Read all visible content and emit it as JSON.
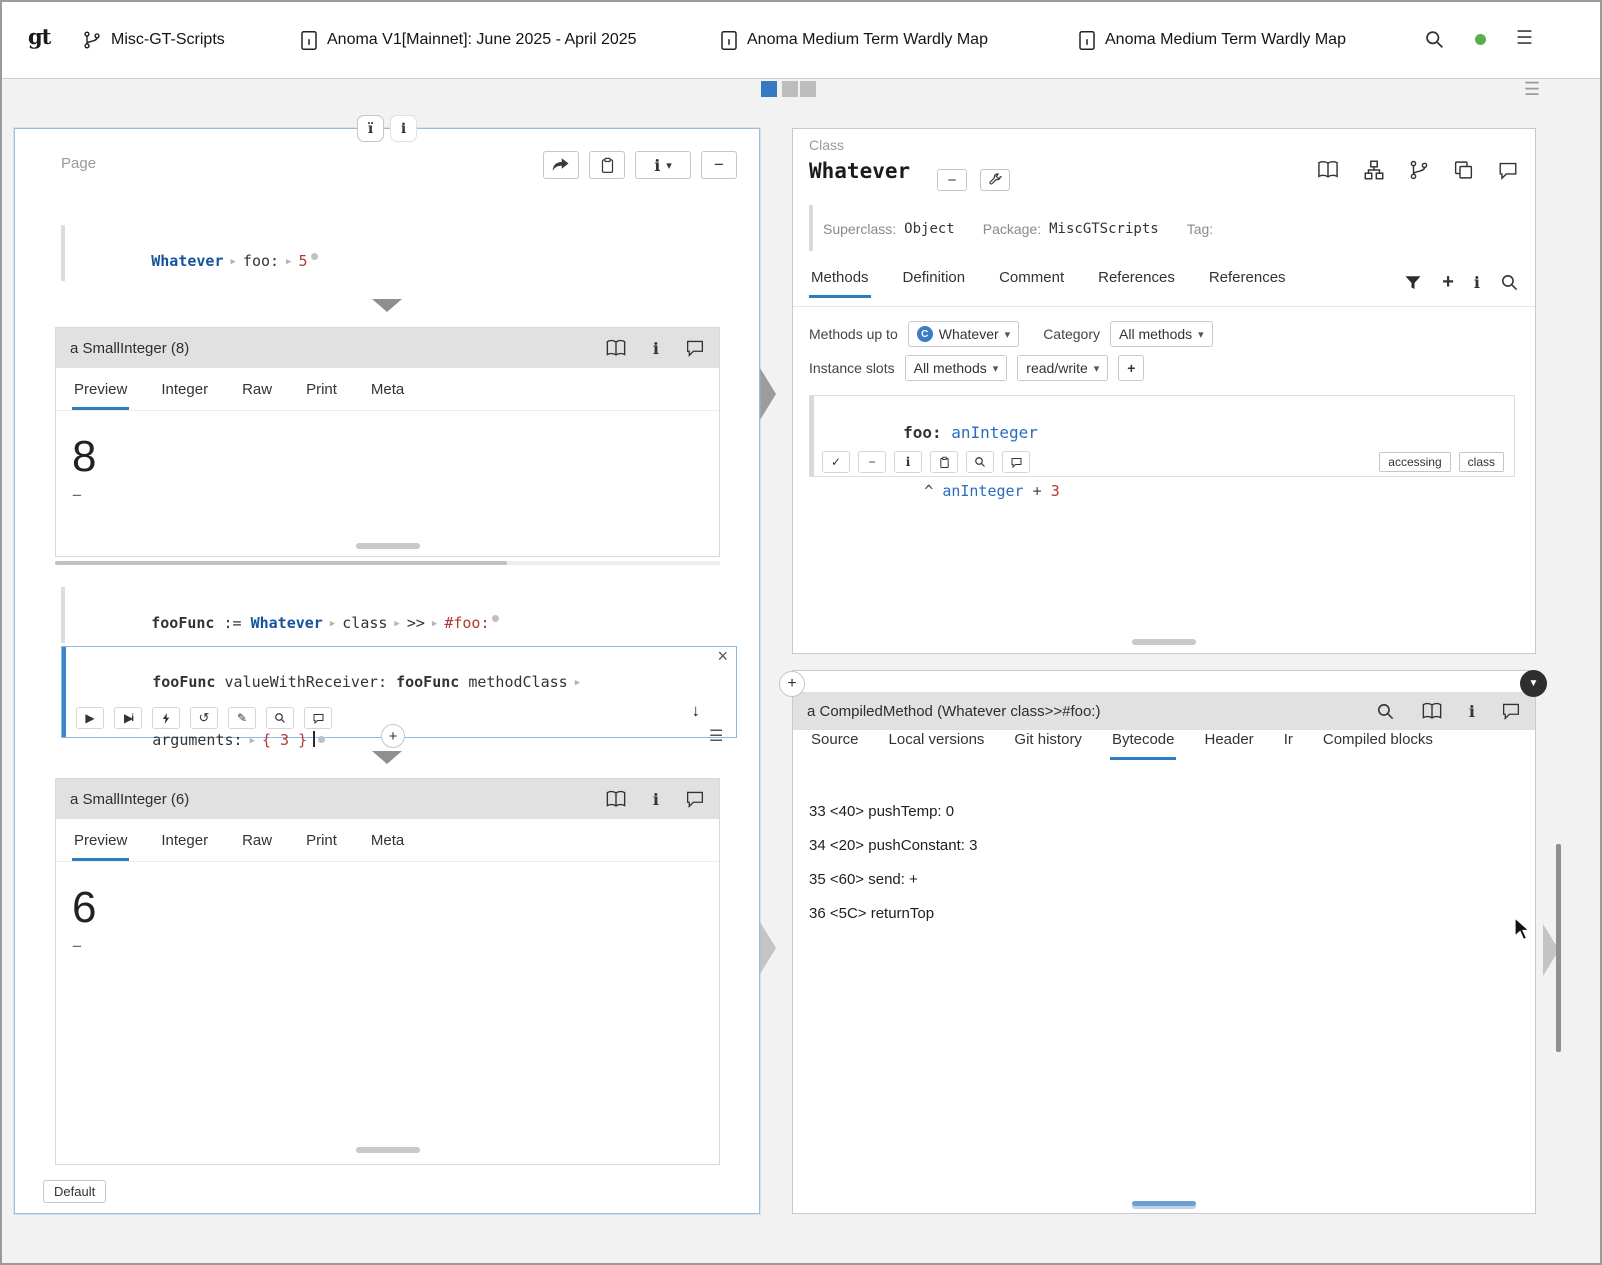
{
  "icons": {
    "logo": "gt",
    "sep": "▶",
    "caret": "▾",
    "minus": "−",
    "plus": "+",
    "close": "×",
    "menu": "☰",
    "check": "✓",
    "pencil": "✎",
    "play": "▶",
    "refresh": "↺",
    "down_arrow": "↓",
    "info": "i",
    "info_remote": "ï",
    "class_badge": "C",
    "collapse_caret": "▼"
  },
  "topbar": {
    "tabs": [
      "Misc-GT-Scripts",
      "Anoma V1[Mainnet]: June 2025 - April 2025",
      "Anoma Medium Term Wardly Map",
      "Anoma Medium Term Wardly Map"
    ]
  },
  "page": {
    "label": "Page",
    "default_button": "Default",
    "snippet1": {
      "receiver": "Whatever",
      "selector": "foo:",
      "arg": "5"
    },
    "inspector1": {
      "title": "a SmallInteger (8)",
      "tabs": [
        "Preview",
        "Integer",
        "Raw",
        "Print",
        "Meta"
      ],
      "value": "8"
    },
    "snippet2": {
      "var": "fooFunc",
      "assign": ":=",
      "receiver": "Whatever",
      "msg1": "class",
      "msg2": ">>",
      "arg": "#foo:"
    },
    "snippet3": {
      "t1": "fooFunc",
      "t2": "valueWithReceiver:",
      "t3": "fooFunc",
      "t4": "methodClass",
      "t5": "arguments:",
      "t6": "{ 3 }"
    },
    "inspector2": {
      "title": "a SmallInteger (6)",
      "tabs": [
        "Preview",
        "Integer",
        "Raw",
        "Print",
        "Meta"
      ],
      "value": "6"
    }
  },
  "class_browser": {
    "kind": "Class",
    "title": "Whatever",
    "superclass_label": "Superclass:",
    "superclass": "Object",
    "package_label": "Package:",
    "package": "MiscGTScripts",
    "tag_label": "Tag:",
    "tabs": [
      "Methods",
      "Definition",
      "Comment",
      "References",
      "References"
    ],
    "filter": {
      "methods_up_to_label": "Methods up to",
      "methods_up_to_value": "Whatever",
      "category_label": "Category",
      "category_value": "All methods",
      "instance_slots_label": "Instance slots",
      "instance_slots_value": "All methods",
      "access_value": "read/write"
    },
    "method": {
      "selector": "foo:",
      "param": "anInteger",
      "caret": "^",
      "var": "anInteger",
      "op": "+",
      "literal": "3",
      "tags": [
        "accessing",
        "class"
      ]
    }
  },
  "method_inspector": {
    "title": "a CompiledMethod (Whatever class>>#foo:)",
    "tabs": [
      "Source",
      "Local versions",
      "Git history",
      "Bytecode",
      "Header",
      "Ir",
      "Compiled blocks"
    ],
    "bytecode": [
      "33 <40> pushTemp: 0",
      "34 <20> pushConstant: 3",
      "35 <60> send: +",
      "36 <5C> returnTop"
    ]
  }
}
